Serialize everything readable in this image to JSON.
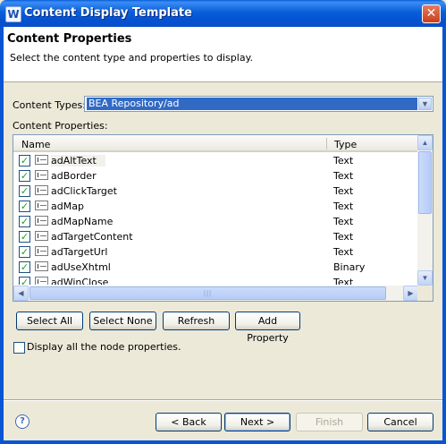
{
  "window": {
    "title": "Content Display Template"
  },
  "header": {
    "title": "Content Properties",
    "description": "Select the content type and properties to display."
  },
  "content_types": {
    "label": "Content Types:",
    "selected": "BEA Repository/ad"
  },
  "content_properties": {
    "label": "Content Properties:",
    "columns": [
      "Name",
      "Type"
    ],
    "rows": [
      {
        "name": "adAltText",
        "type": "Text",
        "checked": true
      },
      {
        "name": "adBorder",
        "type": "Text",
        "checked": true
      },
      {
        "name": "adClickTarget",
        "type": "Text",
        "checked": true
      },
      {
        "name": "adMap",
        "type": "Text",
        "checked": true
      },
      {
        "name": "adMapName",
        "type": "Text",
        "checked": true
      },
      {
        "name": "adTargetContent",
        "type": "Text",
        "checked": true
      },
      {
        "name": "adTargetUrl",
        "type": "Text",
        "checked": true
      },
      {
        "name": "adUseXhtml",
        "type": "Binary",
        "checked": true
      },
      {
        "name": "adWinClose",
        "type": "Text",
        "checked": true
      }
    ]
  },
  "table_buttons": {
    "select_all": "Select All",
    "select_none": "Select None",
    "refresh": "Refresh",
    "add_property": "Add Property"
  },
  "display_all": {
    "label": "Display all the node properties.",
    "checked": false
  },
  "footer": {
    "back": "< Back",
    "next": "Next >",
    "finish": "Finish",
    "cancel": "Cancel"
  }
}
